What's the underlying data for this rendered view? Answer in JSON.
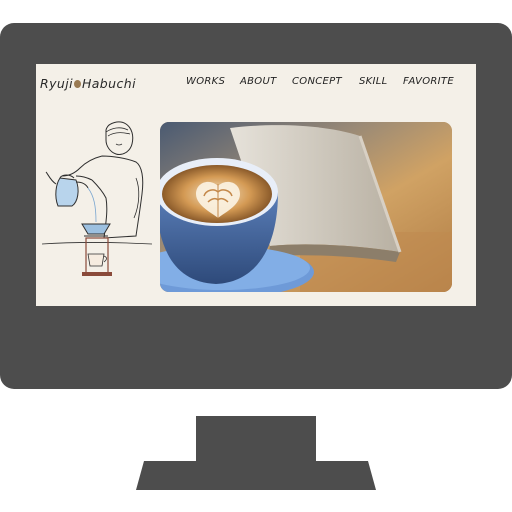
{
  "site": {
    "logo_left": "Ryuji",
    "logo_right": "Habuchi"
  },
  "nav": {
    "items": [
      {
        "label": "WORKS"
      },
      {
        "label": "ABOUT"
      },
      {
        "label": "CONCEPT"
      },
      {
        "label": "SKILL"
      },
      {
        "label": "FAVORITE"
      }
    ]
  },
  "icons": {
    "illustration": "barista-pouring-coffee-illustration",
    "hero": "latte-and-open-book-photo"
  },
  "colors": {
    "monitor": "#4d4d4d",
    "screen_background": "#f4f0e8",
    "cup": "#4a6ea8",
    "latte": "#c8914a"
  }
}
